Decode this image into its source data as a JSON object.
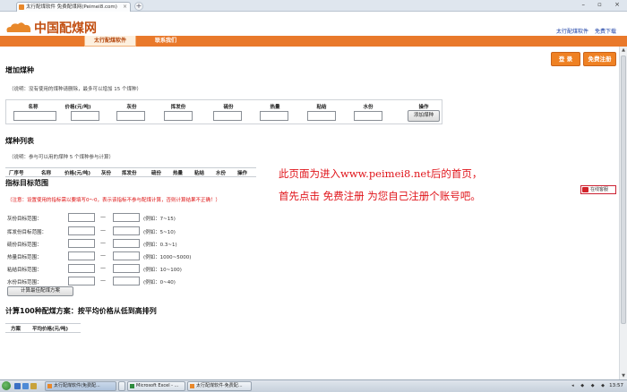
{
  "browser": {
    "tab_title": "太行配煤软件 免费配煤网(Peimei8.com)",
    "tab_close": "×",
    "new_tab": "+",
    "window_controls": "– ▫ ×"
  },
  "site": {
    "logo_text": "中国配煤网",
    "top_links": [
      "太行配煤软件",
      "免费下载"
    ]
  },
  "nav": {
    "items": [
      "太行配煤软件",
      "联系我们"
    ]
  },
  "auth": {
    "login": "登 录",
    "register": "免费注册"
  },
  "add_coal": {
    "title": "增加煤种",
    "note": "（说明：没有使用的煤种请删除，最多可以增加 15 个煤种）",
    "headers": [
      "名称",
      "价格(元/吨)",
      "灰份",
      "挥发份",
      "硫份",
      "热量",
      "粘结",
      "水份",
      "操作"
    ],
    "add_button": "添加煤种"
  },
  "coal_list": {
    "title": "煤种列表",
    "note": "（说明：参与可以用的煤种 5 个煤种参与计算）",
    "headers": [
      "厂序号",
      "名称",
      "价格(元/吨)",
      "灰份",
      "挥发份",
      "硫份",
      "热量",
      "粘结",
      "水份",
      "操作"
    ]
  },
  "targets": {
    "title": "指标目标范围",
    "note": "（注意：设置使用的指标需以要填写0～0，表示该指标不参与配煤计算，否则计算结果不正确！）",
    "rows": [
      {
        "label": "灰份目标范围：",
        "example": "(例如：7~15)"
      },
      {
        "label": "挥发份目标范围：",
        "example": "(例如：5~10)"
      },
      {
        "label": "硫份目标范围：",
        "example": "(例如：0.3~1)"
      },
      {
        "label": "热量目标范围：",
        "example": "(例如：1000~5000)"
      },
      {
        "label": "粘结目标范围：",
        "example": "(例如：10~100)"
      },
      {
        "label": "水份目标范围：",
        "example": "(例如：0~40)"
      }
    ],
    "dash": "—",
    "calc_button": "计算最佳配煤方案"
  },
  "plans": {
    "title": "计算100种配煤方案：按平均价格从低到高排列",
    "headers": [
      "方案",
      "平均价格(元/吨)"
    ]
  },
  "annotation": {
    "line1": "此页面为进入www.peimei8.net后的首页，",
    "line2": "首先点击 免费注册 为您自己注册个账号吧。"
  },
  "service_widget": "在线客服",
  "taskbar": {
    "tasks": [
      "太行配煤软件(免费配...",
      "",
      "Microsoft Excel - ...",
      "太行配煤软件-免费配..."
    ],
    "tray": "◂ ◆ ◆ ◆",
    "clock": "13:57"
  },
  "colors": {
    "brand_orange": "#e9792b",
    "annotation_red": "#e0151b",
    "link_blue": "#1a3fa6"
  }
}
